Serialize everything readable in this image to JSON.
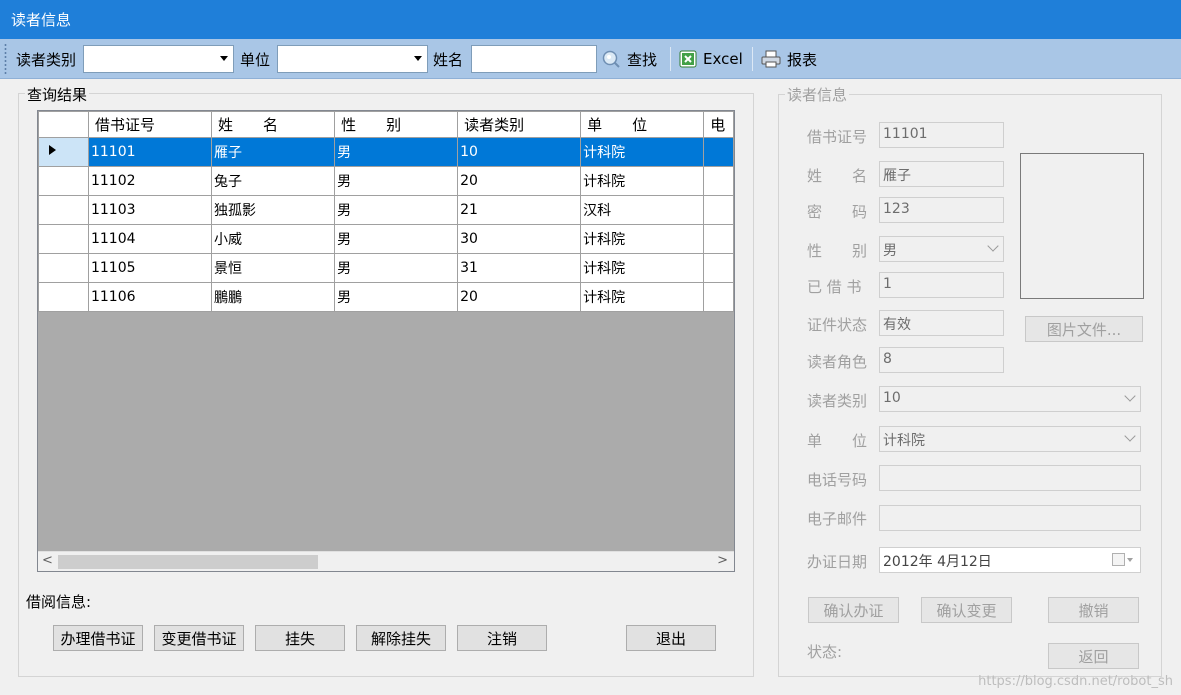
{
  "window": {
    "title": "读者信息"
  },
  "toolbar": {
    "category_label": "读者类别",
    "category_value": "",
    "unit_label": "单位",
    "unit_value": "",
    "name_label": "姓名",
    "name_value": "",
    "search_label": "查找",
    "excel_label": "Excel",
    "report_label": "报表"
  },
  "results": {
    "group_label": "查询结果",
    "columns": [
      "借书证号",
      "姓　　名",
      "性　　别",
      "读者类别",
      "单　　位",
      "电"
    ],
    "rows": [
      [
        "11101",
        "雁子",
        "男",
        "10",
        "计科院",
        ""
      ],
      [
        "11102",
        "兔子",
        "男",
        "20",
        "计科院",
        ""
      ],
      [
        "11103",
        "独孤影",
        "男",
        "21",
        "汉科",
        ""
      ],
      [
        "11104",
        "小威",
        "男",
        "30",
        "计科院",
        ""
      ],
      [
        "11105",
        "景恒",
        "男",
        "31",
        "计科院",
        ""
      ],
      [
        "11106",
        "鵬鵬",
        "男",
        "20",
        "计科院",
        ""
      ]
    ],
    "selected_row": 0,
    "scroll_left": "<",
    "scroll_right": ">"
  },
  "borrow": {
    "label": "借阅信息:",
    "buttons": [
      "办理借书证",
      "变更借书证",
      "挂失",
      "解除挂失",
      "注销"
    ],
    "exit_label": "退出"
  },
  "detail": {
    "group_label": "读者信息",
    "card_no_label": "借书证号",
    "card_no": "11101",
    "name_label": "姓　　名",
    "name": "雁子",
    "password_label": "密　　码",
    "password": "123",
    "gender_label": "性　　别",
    "gender": "男",
    "borrowed_label": "已 借 书",
    "borrowed": "1",
    "status_label": "证件状态",
    "status": "有效",
    "role_label": "读者角色",
    "role": "8",
    "category_label": "读者类别",
    "category": "10",
    "unit_label": "单　　位",
    "unit": "计科院",
    "phone_label": "电话号码",
    "phone": "",
    "email_label": "电子邮件",
    "email": "",
    "date_label": "办证日期",
    "date": "2012年  4月12日",
    "picture_button": "图片文件...",
    "confirm_issue": "确认办证",
    "confirm_change": "确认变更",
    "cancel": "撤销",
    "state_label": "状态:",
    "back": "返回"
  },
  "watermark": "https://blog.csdn.net/robot_sh"
}
